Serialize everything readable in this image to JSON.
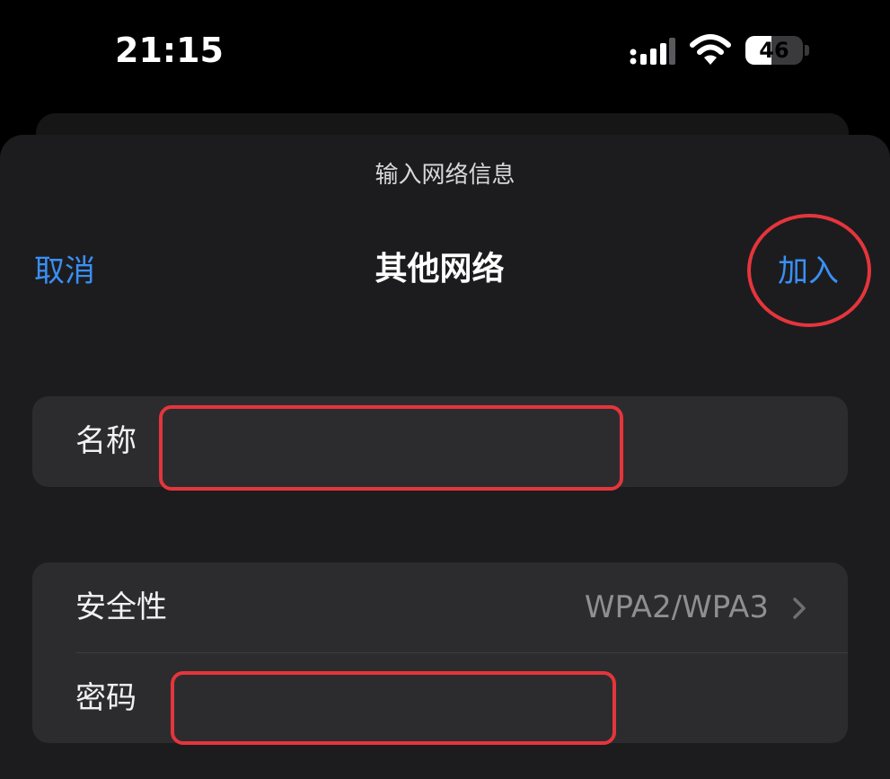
{
  "status_bar": {
    "time": "21:15",
    "battery_level": "46",
    "battery_fraction": 0.46,
    "icons": [
      "signal-icon",
      "wifi-icon",
      "battery-icon"
    ]
  },
  "sheet": {
    "prompt": "输入网络信息",
    "nav": {
      "cancel_label": "取消",
      "title": "其他网络",
      "join_label": "加入"
    },
    "name_row": {
      "label": "名称",
      "value": ""
    },
    "security_row": {
      "label": "安全性",
      "value": "WPA2/WPA3"
    },
    "password_row": {
      "label": "密码",
      "value": ""
    }
  },
  "colors": {
    "background": "#000000",
    "sheet": "#1c1c1e",
    "row": "#2c2c2e",
    "accent": "#3a8ff5",
    "annotation": "#e5353c"
  }
}
